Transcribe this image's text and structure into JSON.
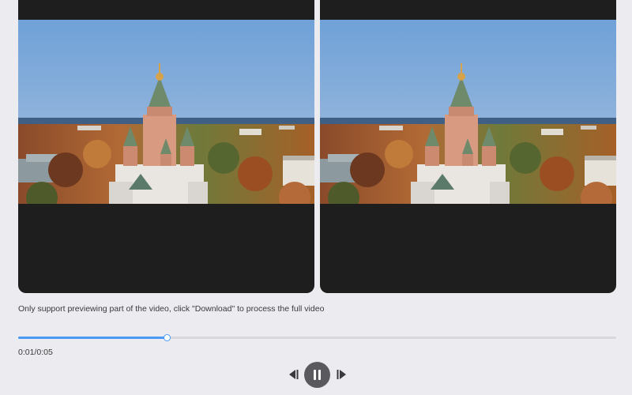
{
  "player": {
    "notice": "Only support previewing part of the video, click \"Download\" to process the full video",
    "time_display": "0:01/0:05",
    "progress": 0.25,
    "state": "playing"
  },
  "controls": {
    "prev_icon": "step-back-icon",
    "pause_icon": "pause-icon",
    "next_icon": "step-forward-icon"
  },
  "colors": {
    "accent": "#4a9af5",
    "panel_bg": "#1e1e1e",
    "page_bg": "#ecebf0"
  }
}
